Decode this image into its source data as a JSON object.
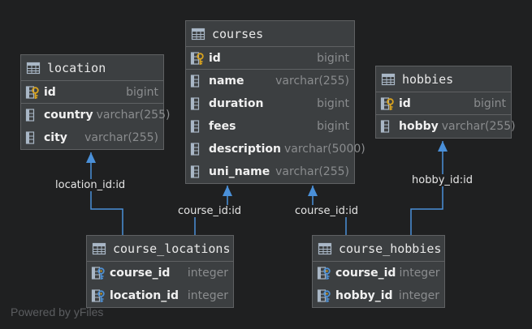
{
  "tables": {
    "location": {
      "name": "location",
      "columns": [
        {
          "name": "id",
          "type": "bigint",
          "kind": "pk"
        },
        {
          "name": "country",
          "type": "varchar(255)",
          "kind": "col"
        },
        {
          "name": "city",
          "type": "varchar(255)",
          "kind": "col"
        }
      ]
    },
    "courses": {
      "name": "courses",
      "columns": [
        {
          "name": "id",
          "type": "bigint",
          "kind": "pk"
        },
        {
          "name": "name",
          "type": "varchar(255)",
          "kind": "col"
        },
        {
          "name": "duration",
          "type": "bigint",
          "kind": "col"
        },
        {
          "name": "fees",
          "type": "bigint",
          "kind": "col"
        },
        {
          "name": "description",
          "type": "varchar(5000)",
          "kind": "col"
        },
        {
          "name": "uni_name",
          "type": "varchar(255)",
          "kind": "col"
        }
      ]
    },
    "hobbies": {
      "name": "hobbies",
      "columns": [
        {
          "name": "id",
          "type": "bigint",
          "kind": "pk"
        },
        {
          "name": "hobby",
          "type": "varchar(255)",
          "kind": "col"
        }
      ]
    },
    "course_locations": {
      "name": "course_locations",
      "columns": [
        {
          "name": "course_id",
          "type": "integer",
          "kind": "fk"
        },
        {
          "name": "location_id",
          "type": "integer",
          "kind": "fk"
        }
      ]
    },
    "course_hobbies": {
      "name": "course_hobbies",
      "columns": [
        {
          "name": "course_id",
          "type": "integer",
          "kind": "fk"
        },
        {
          "name": "hobby_id",
          "type": "integer",
          "kind": "fk"
        }
      ]
    }
  },
  "edge_labels": {
    "location_id": "location_id:id",
    "course_locations_course_id": "course_id:id",
    "course_hobbies_course_id": "course_id:id",
    "hobby_id": "hobby_id:id"
  },
  "watermark": "Powered by yFiles",
  "colors": {
    "background": "#1f2021",
    "table_fill": "#3c3f41",
    "edge": "#4a90d9",
    "key_gold": "#d9a31e",
    "key_blue": "#4f8fd0"
  }
}
